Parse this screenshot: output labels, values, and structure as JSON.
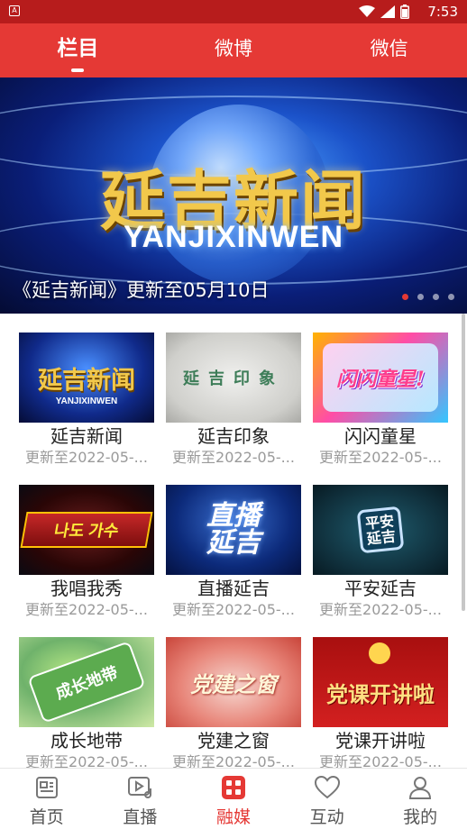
{
  "status_bar": {
    "time": "7:53",
    "app_badge": "A"
  },
  "top_tabs": [
    {
      "label": "栏目",
      "active": true
    },
    {
      "label": "微博",
      "active": false
    },
    {
      "label": "微信",
      "active": false
    }
  ],
  "banner": {
    "logo_text": "延吉新闻",
    "logo_sub": "YANJIXINWEN",
    "caption": "《延吉新闻》更新至05月10日",
    "dot_count": 4,
    "active_dot": 0
  },
  "programs": [
    {
      "title": "延吉新闻",
      "subtitle": "更新至2022-05-...",
      "thumb_text": "延吉新闻",
      "thumb_sub": "YANJIXINWEN"
    },
    {
      "title": "延吉印象",
      "subtitle": "更新至2022-05-...",
      "thumb_text": "延吉印象"
    },
    {
      "title": "闪闪童星",
      "subtitle": "更新至2022-05-...",
      "thumb_text": "闪闪童星!"
    },
    {
      "title": "我唱我秀",
      "subtitle": "更新至2022-05-...",
      "thumb_text": "나도 가수"
    },
    {
      "title": "直播延吉",
      "subtitle": "更新至2022-05-...",
      "thumb_text": "直播延吉"
    },
    {
      "title": "平安延吉",
      "subtitle": "更新至2022-05-...",
      "thumb_text": "平安延吉"
    },
    {
      "title": "成长地带",
      "subtitle": "更新至2022-05-...",
      "thumb_text": "成长地带"
    },
    {
      "title": "党建之窗",
      "subtitle": "更新至2022-05-...",
      "thumb_text": "党建之窗"
    },
    {
      "title": "党课开讲啦",
      "subtitle": "更新至2022-05-...",
      "thumb_text": "党课开讲啦"
    }
  ],
  "bottom_nav": [
    {
      "label": "首页",
      "icon": "news-icon",
      "active": false
    },
    {
      "label": "直播",
      "icon": "live-icon",
      "active": false
    },
    {
      "label": "融媒",
      "icon": "media-icon",
      "active": true
    },
    {
      "label": "互动",
      "icon": "heart-icon",
      "active": false
    },
    {
      "label": "我的",
      "icon": "user-icon",
      "active": false
    }
  ],
  "colors": {
    "brand_red": "#e53935",
    "status_red": "#b71c1c",
    "inactive_gray": "#555555"
  }
}
